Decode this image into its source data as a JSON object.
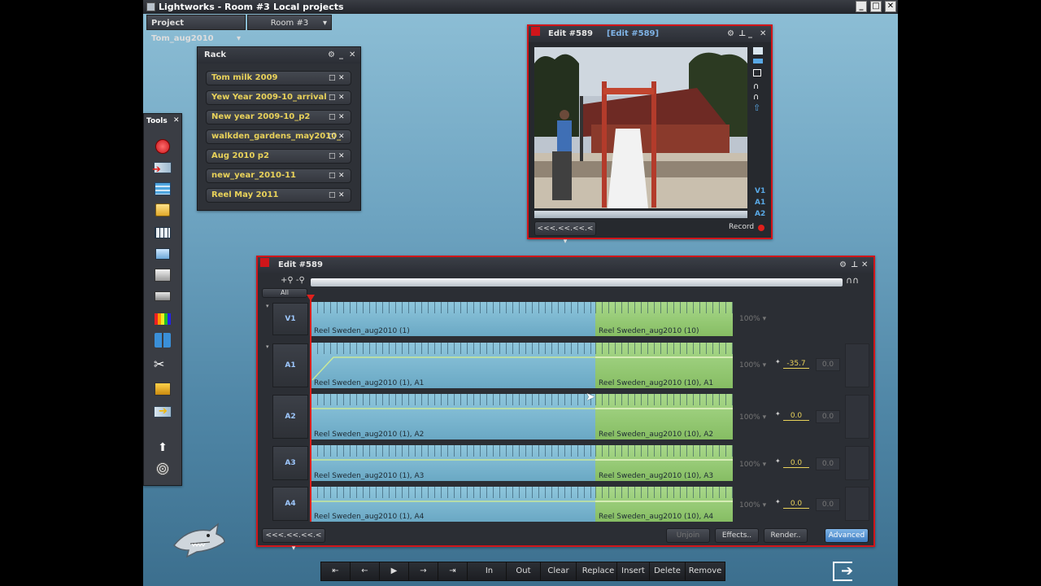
{
  "window": {
    "title": "Lightworks - Room #3",
    "location": "Local projects"
  },
  "projectbar": {
    "project": "Project Tom_aug2010",
    "room": "Room #3"
  },
  "rack": {
    "title": "Rack",
    "items": [
      "Tom milk 2009",
      "Yew Year 2009-10_arrival",
      "New year 2009-10_p2",
      "walkden_gardens_may2010_",
      "Aug 2010 p2",
      "new_year_2010-11",
      "Reel May 2011"
    ]
  },
  "tools": {
    "title": "Tools"
  },
  "viewer": {
    "title": "Edit #589",
    "subtitle": "[Edit #589]",
    "tracks": [
      "V1",
      "A1",
      "A2"
    ],
    "nav_label": "<<<.<<.<<.<",
    "record_label": "Record"
  },
  "timeline": {
    "title": "Edit #589",
    "all_label": "All",
    "tracks": [
      {
        "name": "V1",
        "seg1": "Reel Sweden_aug2010 (1)",
        "seg2": "Reel Sweden_aug2010 (10)",
        "gain": "100%"
      },
      {
        "name": "A1",
        "seg1": "Reel Sweden_aug2010 (1), A1",
        "seg2": "Reel Sweden_aug2010 (10), A1",
        "gain": "100%",
        "level": "-35.7",
        "pan": "0.0"
      },
      {
        "name": "A2",
        "seg1": "Reel Sweden_aug2010 (1), A2",
        "seg2": "Reel Sweden_aug2010 (10), A2",
        "gain": "100%",
        "level": "0.0",
        "pan": "0.0"
      },
      {
        "name": "A3",
        "seg1": "Reel Sweden_aug2010 (1), A3",
        "seg2": "Reel Sweden_aug2010 (10), A3",
        "gain": "100%",
        "level": "0.0",
        "pan": "0.0"
      },
      {
        "name": "A4",
        "seg1": "Reel Sweden_aug2010 (1), A4",
        "seg2": "Reel Sweden_aug2010 (10), A4",
        "gain": "100%",
        "level": "0.0",
        "pan": "0.0"
      }
    ],
    "nav_label": "<<<.<<.<<.<",
    "buttons": {
      "unjoin": "Unjoin",
      "effects": "Effects..",
      "render": "Render..",
      "advanced": "Advanced"
    }
  },
  "transport": {
    "in": "In",
    "out": "Out",
    "clear": "Clear",
    "replace": "Replace",
    "insert": "Insert",
    "delete": "Delete",
    "remove": "Remove"
  },
  "colors": {
    "accent_red": "#d0151a",
    "label_yellow": "#e9d25a",
    "track_blue": "#8ec6dc",
    "track_green": "#a8d88a"
  }
}
